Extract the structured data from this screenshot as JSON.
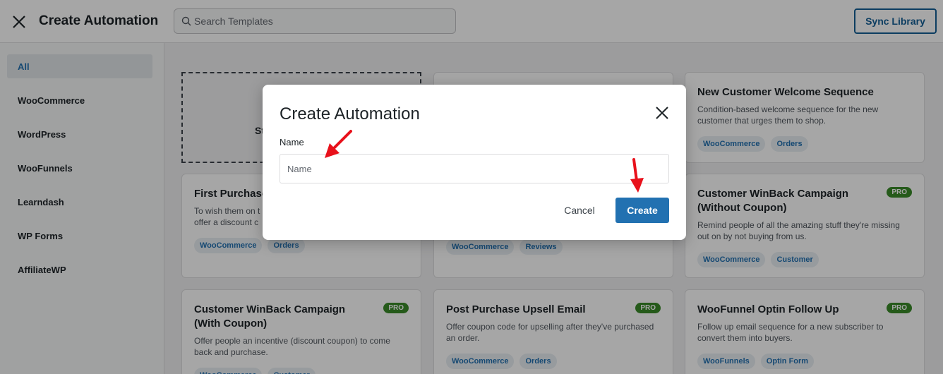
{
  "header": {
    "title": "Create Automation",
    "search_placeholder": "Search Templates",
    "sync_label": "Sync Library"
  },
  "sidebar": {
    "items": [
      {
        "label": "All",
        "active": true
      },
      {
        "label": "WooCommerce"
      },
      {
        "label": "WordPress"
      },
      {
        "label": "WooFunnels"
      },
      {
        "label": "Learndash"
      },
      {
        "label": "WP Forms"
      },
      {
        "label": "AffiliateWP"
      }
    ]
  },
  "cards": [
    {
      "title": "",
      "desc": "",
      "tags": [],
      "pro": false,
      "partial_text": "St"
    },
    {
      "title": "",
      "desc": "",
      "tags": [],
      "pro": false
    },
    {
      "title": "New Customer Welcome Sequence",
      "desc": "Condition-based welcome sequence for the new customer that urges them to shop.",
      "tags": [
        "WooCommerce",
        "Orders"
      ],
      "pro": false
    },
    {
      "title": "First Purchase",
      "desc": "To wish them on t offer a discount c",
      "tags": [
        "WooCommerce",
        "Orders"
      ],
      "pro": false
    },
    {
      "title": "",
      "desc": "",
      "tags": [
        "WooCommerce",
        "Reviews"
      ],
      "pro": false
    },
    {
      "title": "Customer WinBack Campaign (Without Coupon)",
      "desc": "Remind people of all the amazing stuff they're missing out on by not buying from us.",
      "tags": [
        "WooCommerce",
        "Customer"
      ],
      "pro": true
    },
    {
      "title": "Customer WinBack Campaign (With Coupon)",
      "desc": "Offer people an incentive (discount coupon) to come back and purchase.",
      "tags": [
        "WooCommerce",
        "Customer"
      ],
      "pro": true
    },
    {
      "title": "Post Purchase Upsell Email",
      "desc": "Offer coupon code for upselling after they've purchased an order.",
      "tags": [
        "WooCommerce",
        "Orders"
      ],
      "pro": true
    },
    {
      "title": "WooFunnel Optin Follow Up",
      "desc": "Follow up email sequence for a new subscriber to convert them into buyers.",
      "tags": [
        "WooFunnels",
        "Optin Form"
      ],
      "pro": true
    }
  ],
  "pro_label": "PRO",
  "modal": {
    "title": "Create Automation",
    "name_label": "Name",
    "name_placeholder": "Name",
    "name_value": "",
    "cancel_label": "Cancel",
    "create_label": "Create"
  },
  "colors": {
    "accent": "#2271b1",
    "pro_badge": "#3a8a28",
    "arrow": "#e8111b"
  }
}
